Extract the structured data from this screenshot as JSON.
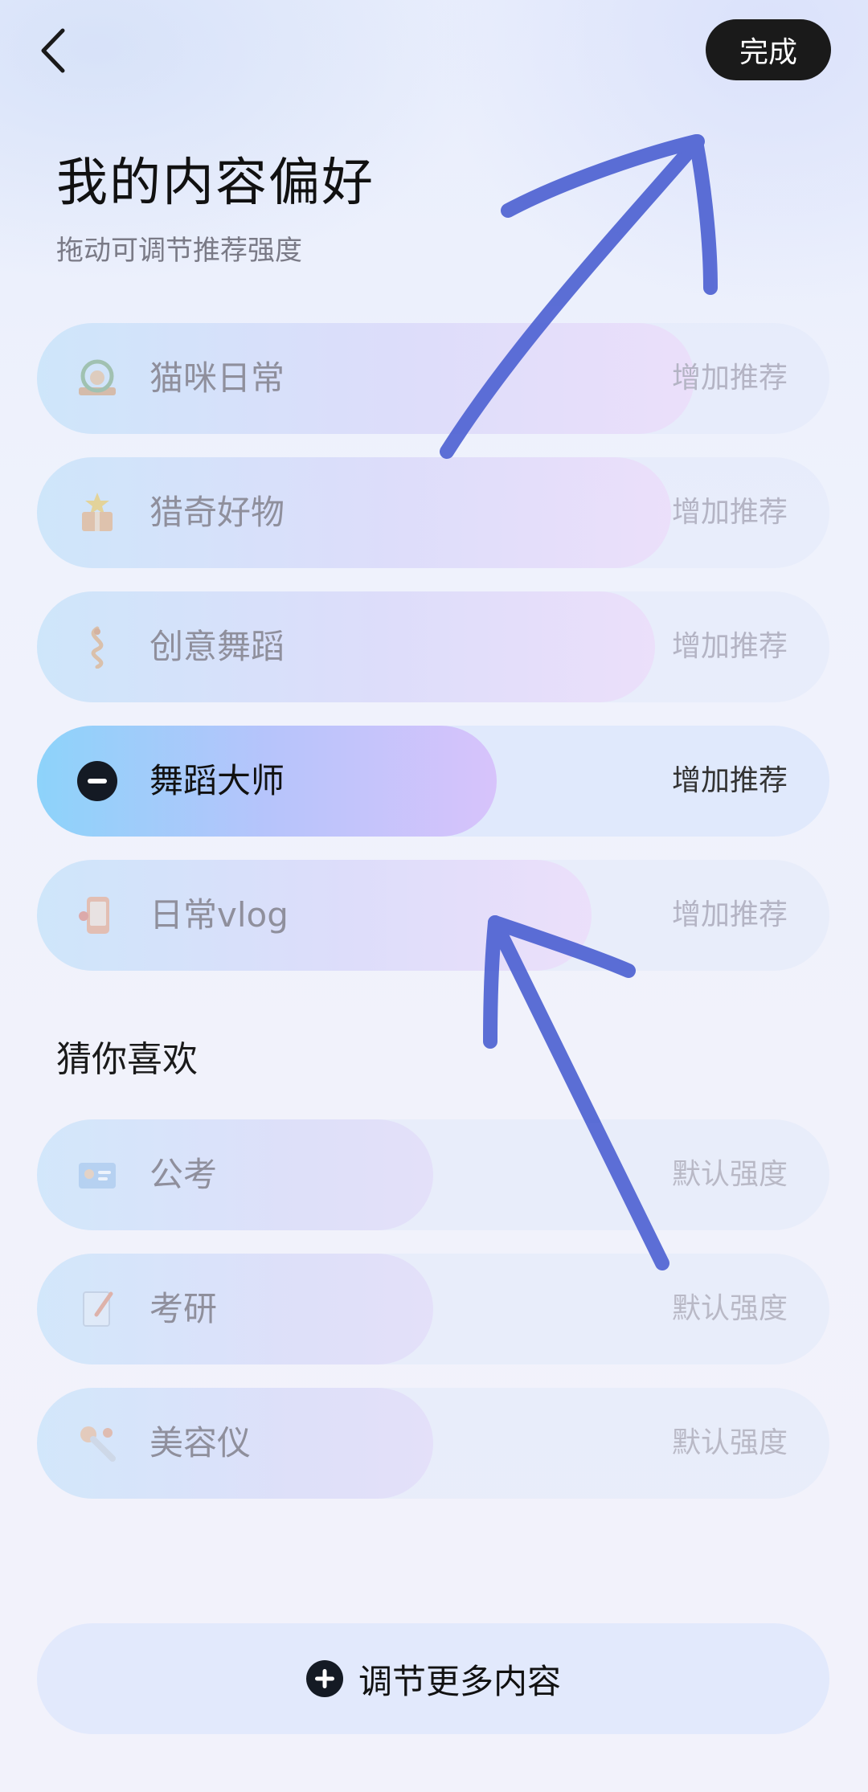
{
  "header": {
    "done_label": "完成",
    "back_icon": "chevron-left-icon"
  },
  "page": {
    "title": "我的内容偏好",
    "subtitle": "拖动可调节推荐强度"
  },
  "preferences": [
    {
      "label": "猫咪日常",
      "action": "增加推荐",
      "icon": "cat-frame-icon",
      "level": 0.83
    },
    {
      "label": "猎奇好物",
      "action": "增加推荐",
      "icon": "gift-box-icon",
      "level": 0.8
    },
    {
      "label": "创意舞蹈",
      "action": "增加推荐",
      "icon": "dance-ribbon-icon",
      "level": 0.78
    },
    {
      "label": "舞蹈大师",
      "action": "增加推荐",
      "icon": "minus-circle-icon",
      "level": 0.58,
      "active": true
    },
    {
      "label": "日常vlog",
      "action": "增加推荐",
      "icon": "phone-icon",
      "level": 0.7
    }
  ],
  "suggestions_title": "猜你喜欢",
  "suggestions": [
    {
      "label": "公考",
      "action": "默认强度",
      "icon": "id-card-icon",
      "level": 0.5
    },
    {
      "label": "考研",
      "action": "默认强度",
      "icon": "notebook-icon",
      "level": 0.5
    },
    {
      "label": "美容仪",
      "action": "默认强度",
      "icon": "beauty-device-icon",
      "level": 0.5
    }
  ],
  "more_button": {
    "label": "调节更多内容",
    "icon": "plus-circle-icon"
  },
  "colors": {
    "accent_dark": "#1a1a1a",
    "annotation": "#4f63d2"
  }
}
